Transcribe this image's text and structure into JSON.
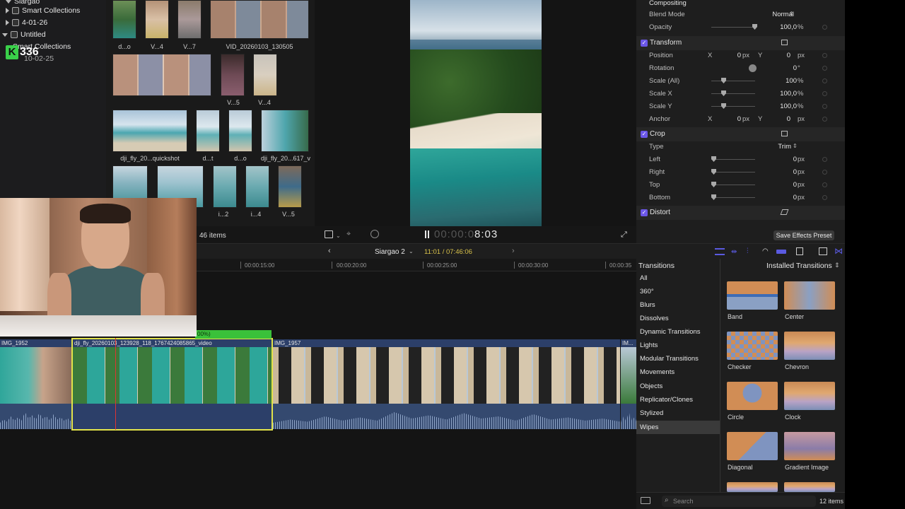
{
  "sidebar": {
    "items": [
      {
        "label": "Siargao",
        "expanded": true
      },
      {
        "label": "Smart Collections",
        "expanded": false
      },
      {
        "label": "4-01-26",
        "expanded": false
      },
      {
        "label": "Untitled",
        "expanded": true
      },
      {
        "label": "Smart Collections",
        "expanded": false
      },
      {
        "label": "10-02-25",
        "expanded": false
      }
    ],
    "badge": {
      "letter": "K",
      "number": "336"
    }
  },
  "browser": {
    "labels": [
      "d...o",
      "V...4",
      "V...7",
      "VID_20260103_130505",
      "V...5",
      "V...4",
      "dji_fly_20...quickshot",
      "d...t",
      "d...o",
      "dji_fly_20...617_v",
      "i...2",
      "i...4",
      "V...5"
    ],
    "items_count": "46 items"
  },
  "viewer": {
    "timecode_dim": "00:00:0",
    "timecode_bright": "8:03"
  },
  "inspector": {
    "compositing": "Compositing",
    "blend_mode_label": "Blend Mode",
    "blend_mode_value": "Normal",
    "opacity_label": "Opacity",
    "opacity_value": "100,0",
    "percent": "%",
    "transform": "Transform",
    "position_label": "Position",
    "position_x": "0",
    "position_y": "0",
    "px": "px",
    "x": "X",
    "y": "Y",
    "rotation_label": "Rotation",
    "rotation_value": "0",
    "degree": "°",
    "scale_all_label": "Scale (All)",
    "scale_all_value": "100",
    "scale_x_label": "Scale X",
    "scale_x_value": "100,0",
    "scale_y_label": "Scale Y",
    "scale_y_value": "100,0",
    "anchor_label": "Anchor",
    "anchor_x": "0",
    "anchor_y": "0",
    "crop": "Crop",
    "type_label": "Type",
    "type_value": "Trim",
    "left_label": "Left",
    "right_label": "Right",
    "top_label": "Top",
    "bottom_label": "Bottom",
    "zero": "0",
    "distort": "Distort",
    "save_preset": "Save Effects Preset"
  },
  "timeline": {
    "project": "Siargao 2",
    "timecode": "11:01 / 07:46:06",
    "ruler": [
      "00:00:15:00",
      "00:00:20:00",
      "00:00:25:00",
      "00:00:30:00",
      "00:00:35"
    ],
    "clips": [
      {
        "name": "IMG_1952"
      },
      {
        "name": "dji_fly_20260103_123928_118_1767424085865_video"
      },
      {
        "name": "IMG_1957"
      },
      {
        "name": "IM..."
      }
    ],
    "retime_tag": "00%)"
  },
  "transitions": {
    "title": "Transitions",
    "installed": "Installed Transitions",
    "categories": [
      "All",
      "360°",
      "Blurs",
      "Dissolves",
      "Dynamic Transitions",
      "Lights",
      "Modular Transitions",
      "Movements",
      "Objects",
      "Replicator/Clones",
      "Stylized",
      "Wipes"
    ],
    "selected": "Wipes",
    "items": [
      "Band",
      "Center",
      "Checker",
      "Chevron",
      "Circle",
      "Clock",
      "Diagonal",
      "Gradient Image"
    ],
    "search_placeholder": "Search",
    "count": "12 items"
  }
}
